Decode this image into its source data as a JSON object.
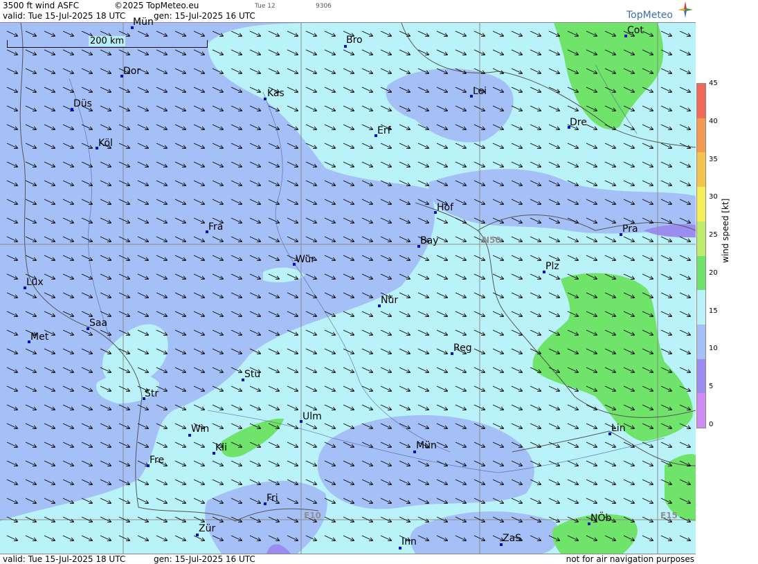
{
  "header": {
    "product": "3500 ft wind ASFC",
    "copyright": "©2025 TopMeteo.eu",
    "valid": "valid:  Tue  15-Jul-2025  18 UTC",
    "gen": "gen: 15-Jul-2025 16 UTC",
    "small1": "Tue 12",
    "small2": "9306",
    "logo": "TopMeteo"
  },
  "footer": {
    "valid": "valid:  Tue  15-Jul-2025  18 UTC",
    "gen": "gen: 15-Jul-2025 16 UTC",
    "disclaimer": "not for air navigation purposes"
  },
  "scale_label": "200 km",
  "grid_labels": {
    "n50": "N50",
    "e10": "E10",
    "e15": "E15"
  },
  "legend": {
    "title": "wind  speed  [kt]",
    "ticks": [
      "45",
      "40",
      "35",
      "30",
      "25",
      "20",
      "15",
      "10",
      "5",
      "0"
    ],
    "colors": [
      "#f06a5a",
      "#f29a52",
      "#f5c44f",
      "#f3f05a",
      "#bdeb6b",
      "#6fe36a",
      "#b9f2f8",
      "#a5c0f7",
      "#9b8cf0",
      "#cf8cf5"
    ]
  },
  "cities": [
    {
      "name": "Mün"
    },
    {
      "name": "Bro"
    },
    {
      "name": "Cot"
    },
    {
      "name": "Dor"
    },
    {
      "name": "Kas"
    },
    {
      "name": "Lei"
    },
    {
      "name": "Düs"
    },
    {
      "name": "Erf"
    },
    {
      "name": "Dre"
    },
    {
      "name": "Köl"
    },
    {
      "name": "Hof"
    },
    {
      "name": "Fra"
    },
    {
      "name": "Pra"
    },
    {
      "name": "Bay"
    },
    {
      "name": "Wür"
    },
    {
      "name": "Plz"
    },
    {
      "name": "Lux"
    },
    {
      "name": "Nür"
    },
    {
      "name": "Saa"
    },
    {
      "name": "Met"
    },
    {
      "name": "Reg"
    },
    {
      "name": "Stu"
    },
    {
      "name": "Str"
    },
    {
      "name": "Ulm"
    },
    {
      "name": "Win"
    },
    {
      "name": "Lin"
    },
    {
      "name": "Kli"
    },
    {
      "name": "Mün"
    },
    {
      "name": "Fre"
    },
    {
      "name": "Fri"
    },
    {
      "name": "NÖb"
    },
    {
      "name": "Zür"
    },
    {
      "name": "ZaS"
    },
    {
      "name": "Inn"
    }
  ],
  "colors": {
    "slow": "#a5c0f7",
    "medium": "#b9f2f8",
    "fast": "#6fe36a",
    "violet": "#9b8cf0"
  }
}
